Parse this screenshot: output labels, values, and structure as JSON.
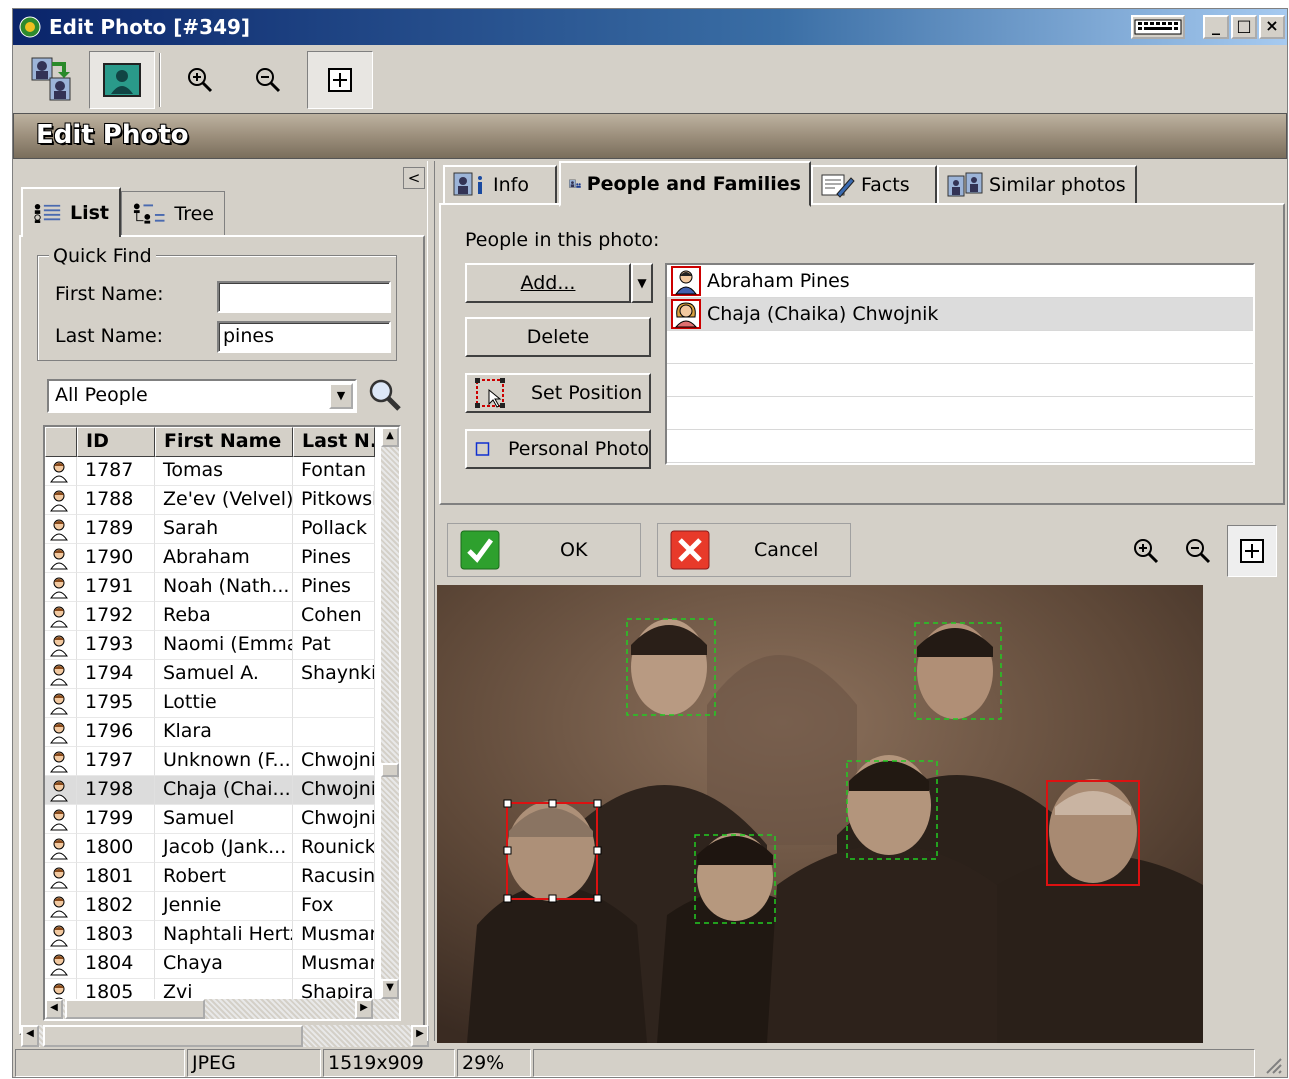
{
  "window": {
    "title": "Edit Photo [#349]"
  },
  "toolbar": {
    "buttons": [
      {
        "icon": "link-persons-icon"
      },
      {
        "icon": "edit-photo-icon",
        "pressed": true
      },
      {
        "icon": "zoom-in-icon"
      },
      {
        "icon": "zoom-out-icon"
      },
      {
        "icon": "fit-to-window-icon"
      }
    ]
  },
  "header": {
    "title": "Edit Photo"
  },
  "left": {
    "tabs": [
      {
        "label": "List",
        "active": true
      },
      {
        "label": "Tree",
        "active": false
      }
    ],
    "quick_find": {
      "title": "Quick Find",
      "first_name_label": "First Name:",
      "first_name_value": "",
      "last_name_label": "Last Name:",
      "last_name_value": "pines"
    },
    "filter": {
      "selected": "All People"
    },
    "grid": {
      "columns": [
        "",
        "ID",
        "First Name",
        "Last N..."
      ],
      "rows": [
        {
          "id": "1787",
          "first": "Tomas",
          "last": "Fontan"
        },
        {
          "id": "1788",
          "first": "Ze'ev (Velvel)",
          "last": "Pitkowsk"
        },
        {
          "id": "1789",
          "first": "Sarah",
          "last": "Pollack"
        },
        {
          "id": "1790",
          "first": "Abraham",
          "last": "Pines"
        },
        {
          "id": "1791",
          "first": "Noah (Nath...",
          "last": "Pines"
        },
        {
          "id": "1792",
          "first": "Reba",
          "last": "Cohen"
        },
        {
          "id": "1793",
          "first": "Naomi (Emma)",
          "last": "Pat"
        },
        {
          "id": "1794",
          "first": "Samuel A.",
          "last": "Shaynkin"
        },
        {
          "id": "1795",
          "first": "Lottie",
          "last": ""
        },
        {
          "id": "1796",
          "first": "Klara",
          "last": ""
        },
        {
          "id": "1797",
          "first": "Unknown (F...",
          "last": "Chwojnik"
        },
        {
          "id": "1798",
          "first": "Chaja (Chai...",
          "last": "Chwojnik",
          "selected": true
        },
        {
          "id": "1799",
          "first": "Samuel",
          "last": "Chwojnik"
        },
        {
          "id": "1800",
          "first": "Jacob (Jank...",
          "last": "Rounick"
        },
        {
          "id": "1801",
          "first": "Robert",
          "last": "Racusin"
        },
        {
          "id": "1802",
          "first": "Jennie",
          "last": "Fox"
        },
        {
          "id": "1803",
          "first": "Naphtali Hertz",
          "last": "Musman"
        },
        {
          "id": "1804",
          "first": "Chaya",
          "last": "Musman"
        },
        {
          "id": "1805",
          "first": "Zvi",
          "last": "Shapira"
        }
      ]
    }
  },
  "right": {
    "tabs": [
      {
        "label": "Info",
        "icon": "info-icon"
      },
      {
        "label": "People and Families",
        "icon": "people-icon",
        "active": true
      },
      {
        "label": "Facts",
        "icon": "facts-icon"
      },
      {
        "label": "Similar photos",
        "icon": "similar-photos-icon"
      }
    ],
    "people_label": "People in this photo:",
    "buttons": {
      "add": "Add...",
      "delete": "Delete",
      "set_position": "Set Position",
      "personal_photo": "Personal Photo"
    },
    "people": [
      {
        "name": "Abraham Pines",
        "gender": "male"
      },
      {
        "name": "Chaja (Chaika) Chwojnik",
        "gender": "female",
        "selected": true
      }
    ],
    "ok_label": "OK",
    "cancel_label": "Cancel"
  },
  "status": {
    "format": "JPEG",
    "dimensions": "1519x909",
    "zoom": "29%"
  },
  "colors": {
    "title_bar": "#0a246a",
    "face_box_tagged": "#dd1111",
    "face_box_untagged": "#22cc22"
  }
}
